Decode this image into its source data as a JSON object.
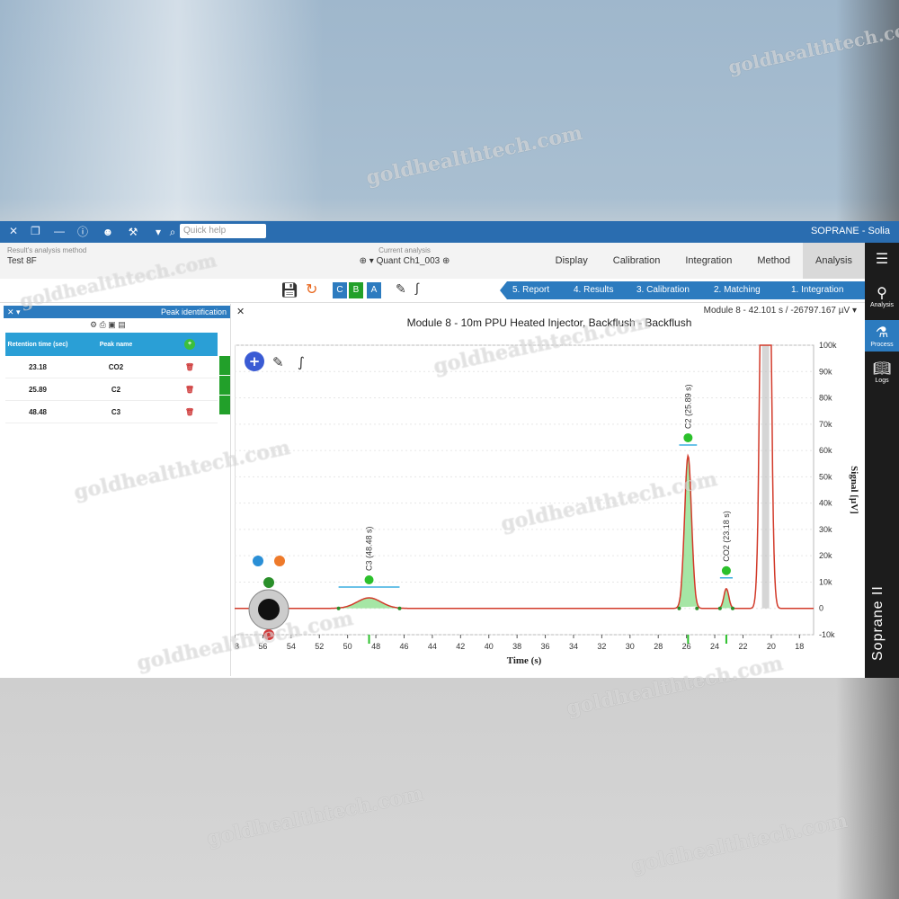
{
  "app": {
    "name": "SOPRANE - Solia",
    "search_placeholder": "Quick help",
    "brand": "Soprane II"
  },
  "info": {
    "current_analysis_label": "Current analysis",
    "current_analysis_value": "Quant Ch1_003",
    "method_label": "Result's analysis method",
    "method_value": "Test 8F"
  },
  "menu_tabs": [
    "Analysis",
    "Method",
    "Integration",
    "Calibration",
    "Display"
  ],
  "steps": [
    "1. Integration",
    "2. Matching",
    "3. Calibration",
    "4. Results",
    "5. Report"
  ],
  "abc": [
    "A",
    "B",
    "C"
  ],
  "sidebar": [
    "Analysis",
    "Process",
    "Logs"
  ],
  "chart": {
    "title": "Module 8 - 10m PPU Heated Injector, Backflush - Backflush",
    "meta": "Module 8 - 42.101 s / -26797.167 µV",
    "xlabel": "Time (s)",
    "ylabel": "Signal [µV]"
  },
  "peak_panel": {
    "title": "Peak identification",
    "col_name": "Peak name",
    "col_rt": "Retention time (sec)",
    "rows": [
      {
        "name": "CO2",
        "rt": "23.18"
      },
      {
        "name": "C2",
        "rt": "25.89"
      },
      {
        "name": "C3",
        "rt": "48.48"
      }
    ]
  },
  "watermark": "goldhealthtech.com",
  "chart_data": {
    "type": "line",
    "x_label": "Time (s)",
    "y_label": "Signal [µV]",
    "xlim": [
      58,
      17
    ],
    "ylim": [
      -10000,
      100000
    ],
    "x_ticks": [
      58,
      56,
      54,
      52,
      50,
      48,
      46,
      44,
      42,
      40,
      38,
      36,
      34,
      32,
      30,
      28,
      26,
      24,
      22,
      20,
      18
    ],
    "y_ticks": [
      "-10k",
      "0",
      "10k",
      "20k",
      "30k",
      "40k",
      "50k",
      "60k",
      "70k",
      "80k",
      "90k",
      "100k"
    ],
    "peaks": [
      {
        "label": "C3 (48.48 s)",
        "x": 48.48,
        "y": 4000
      },
      {
        "label": "C2 (25.89 s)",
        "x": 25.89,
        "y": 58000
      },
      {
        "label": "CO2 (23.18 s)",
        "x": 23.18,
        "y": 7500
      }
    ],
    "off_scale_peak_x": 20.4,
    "baseline": 0
  }
}
